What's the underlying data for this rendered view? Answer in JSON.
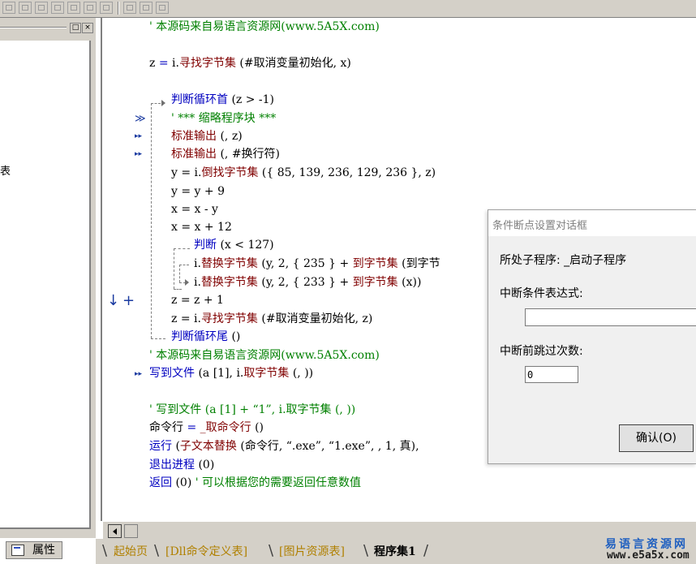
{
  "left_panel": {
    "close_label": "×",
    "restore_label": "□",
    "fragment_text": "表",
    "props_tab_label": "属性"
  },
  "code": {
    "l01": "' 本源码来自易语言资源网(www.5A5X.com)",
    "l02_a": "z",
    "l02_b": " = ",
    "l02_c": "i.",
    "l02_d": "寻找字节集",
    "l02_e": " (#取消变量初始化, x)",
    "l03_a": "判断循环首",
    "l03_b": " (z > -1)",
    "l04": "' *** 缩略程序块 ***",
    "l05_a": "标准输出",
    "l05_b": " (, z)",
    "l06_a": "标准输出",
    "l06_b": " (, #换行符)",
    "l07_a": "y = i.",
    "l07_b": "倒找字节集",
    "l07_c": " ({ 85, 139, 236, 129, 236 }, z)",
    "l08": "y = y + 9",
    "l09": "x = x - y",
    "l10": "x = x + 12",
    "l11_a": "判断",
    "l11_b": " (x < 127)",
    "l12_a": "i.",
    "l12_b": "替换字节集",
    "l12_c": " (y, 2, { 235 } + ",
    "l12_d": "到字节集",
    "l12_e": " (到字节",
    "l13_a": "i.",
    "l13_b": "替换字节集",
    "l13_c": " (y, 2, { 233 } + ",
    "l13_d": "到字节集",
    "l13_e": " (x))",
    "l14": "z = z + 1",
    "l15_a": "z = i.",
    "l15_b": "寻找字节集",
    "l15_c": " (#取消变量初始化, z)",
    "l16_a": "判断循环尾",
    "l16_b": " ()",
    "l17": "' 本源码来自易语言资源网(www.5A5X.com)",
    "l18_a": "写到文件",
    "l18_b": " (a [1], i.",
    "l18_c": "取字节集",
    "l18_d": " (, ))",
    "l19": "' 写到文件 (a [1] + “1”, i.取字节集 (, ))",
    "l20_a": "命令行",
    "l20_b": " = ",
    "l20_c": "_取命令行",
    "l20_d": " ()",
    "l21_a": "运行",
    "l21_b": " (",
    "l21_c": "子文本替换",
    "l21_d": " (命令行, “.exe”, “1.exe”, , 1, 真),",
    "l22_a": "退出进程",
    "l22_b": " (0)",
    "l23_a": "返回",
    "l23_b": " (0)",
    "l23_c": " ' 可以根据您的需要返回任意数值"
  },
  "markers": {
    "double_chevron": "≫",
    "mini_arrow": "▸▸",
    "bp_arrow": "↓",
    "bp_plus": "+"
  },
  "tabs": {
    "t1": "起始页",
    "t2": "[Dll命令定义表]",
    "t3": "[图片资源表]",
    "t4": "程序集1"
  },
  "dialog": {
    "title": "条件断点设置对话框",
    "subprogram_label": "所处子程序: _启动子程序",
    "condition_label": "中断条件表达式:",
    "condition_value": "",
    "skip_label": "中断前跳过次数:",
    "skip_value": "0",
    "ok_label": "确认(O)"
  },
  "watermark": {
    "cn": "易语言资源网",
    "url": "www.e5a5x.com"
  },
  "colors": {
    "comment": "#008000",
    "keyword": "#0000c0",
    "command": "#800000",
    "chrome": "#d4d0c8"
  }
}
